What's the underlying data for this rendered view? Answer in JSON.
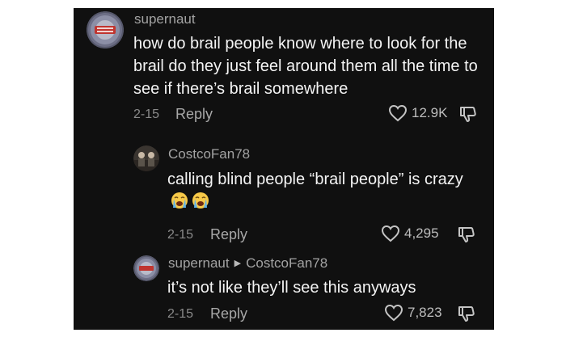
{
  "comments": [
    {
      "username": "supernaut",
      "text": "how do brail people know where to look for the brail do they just feel around them all the time to see if there’s brail somewhere",
      "date": "2-15",
      "reply_label": "Reply",
      "likes": "12.9K"
    },
    {
      "username": "CostcoFan78",
      "text": "calling blind people “brail people” is crazy",
      "emoji": [
        "loudly-crying-face",
        "loudly-crying-face"
      ],
      "date": "2-15",
      "reply_label": "Reply",
      "likes": "4,295"
    },
    {
      "username": "supernaut",
      "reply_to": "CostcoFan78",
      "text": "it’s not like they’ll see this anyways",
      "date": "2-15",
      "reply_label": "Reply",
      "likes": "7,823"
    }
  ],
  "colors": {
    "background": "#101010",
    "text": "#f4f4f4",
    "username": "#a3a3a3",
    "meta": "#8a8a8a"
  }
}
